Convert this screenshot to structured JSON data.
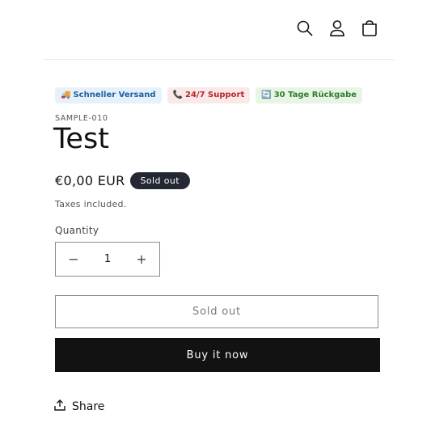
{
  "header": {
    "icons": [
      "search-icon",
      "account-icon",
      "cart-icon"
    ]
  },
  "badges": [
    {
      "icon": "🚚",
      "label": "Schneller Versand",
      "bg": "#e7f1fb",
      "color": "#1f5fa0"
    },
    {
      "icon": "📞",
      "label": "24/7 Support",
      "bg": "#fbe9ea",
      "color": "#b3262d"
    },
    {
      "icon": "🔄",
      "label": "30 Tage Rückgabe",
      "bg": "#e8f5e6",
      "color": "#2f7d2c"
    }
  ],
  "product": {
    "sku": "SAMPLE-010",
    "title": "Test",
    "price": "€0,00 EUR",
    "status_badge": "Sold out",
    "taxes": "Taxes included."
  },
  "quantity": {
    "label": "Quantity",
    "value": "1",
    "minus": "−",
    "plus": "+"
  },
  "buttons": {
    "sold_out": "Sold out",
    "buy_now": "Buy it now"
  },
  "share": {
    "label": "Share"
  }
}
